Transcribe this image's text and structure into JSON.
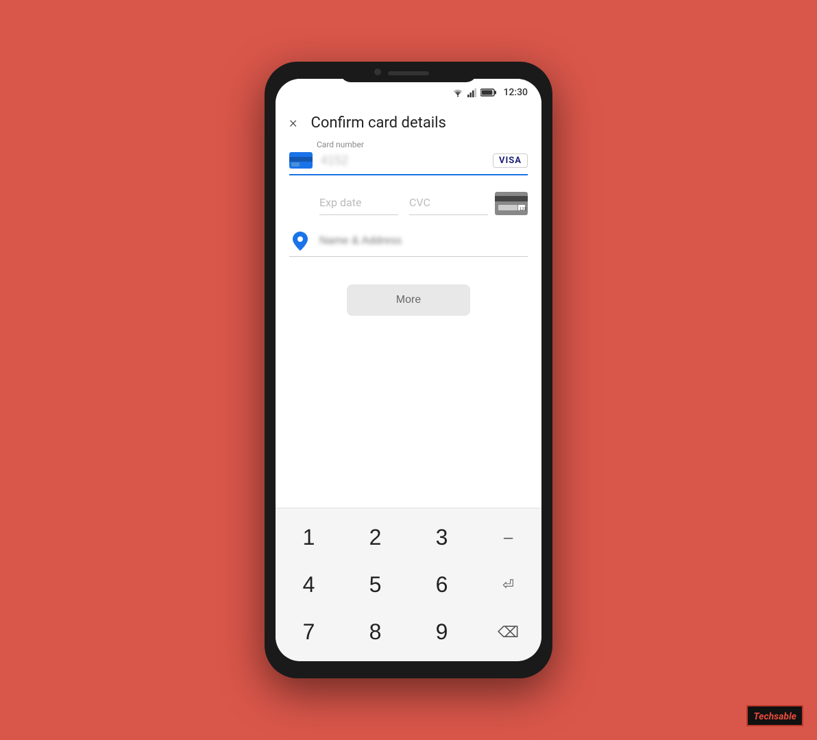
{
  "statusBar": {
    "time": "12:30"
  },
  "header": {
    "closeLabel": "×",
    "title": "Confirm card details"
  },
  "form": {
    "cardNumber": {
      "label": "Card number",
      "placeholder": "4152",
      "cardType": "VISA"
    },
    "expDate": {
      "placeholder": "Exp date"
    },
    "cvc": {
      "placeholder": "CVC"
    },
    "nameAddress": {
      "placeholder": "Name & Address"
    }
  },
  "moreButton": {
    "label": "More"
  },
  "keypad": {
    "rows": [
      [
        "1",
        "2",
        "3",
        "–"
      ],
      [
        "4",
        "5",
        "6",
        "⏎"
      ],
      [
        "7",
        "8",
        "9",
        "⌫"
      ]
    ]
  },
  "watermark": {
    "text": "Techsable"
  }
}
